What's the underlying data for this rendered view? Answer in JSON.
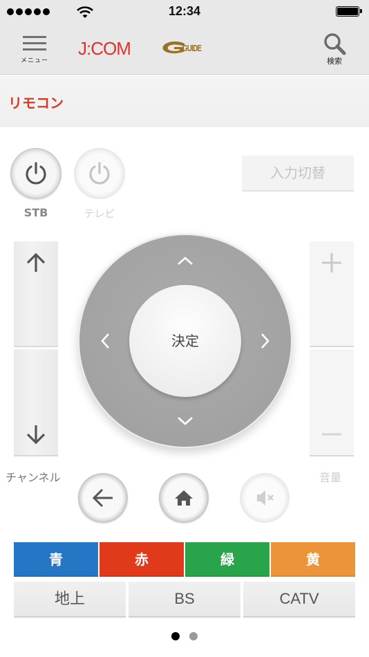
{
  "status_bar": {
    "time": "12:34",
    "signal_bars": 5,
    "wifi_icon": "wifi-icon",
    "battery_icon": "battery-full-icon"
  },
  "header": {
    "menu_label": "メニュー",
    "menu_icon": "hamburger-menu-icon",
    "brand_logo": "J:COM",
    "guide_logo": "GUIDE",
    "search_label": "検索",
    "search_icon": "magnifier-icon",
    "brand_color": "#e2312a"
  },
  "page": {
    "title": "リモコン",
    "title_color": "#d73a22"
  },
  "power": {
    "stb_label": "STB",
    "tv_label": "テレビ",
    "stb_enabled": true,
    "tv_enabled": false
  },
  "input_switch": {
    "label": "入力切替",
    "enabled": false
  },
  "channel": {
    "label": "チャンネル",
    "up_icon": "arrow-up-icon",
    "down_icon": "arrow-down-icon"
  },
  "volume": {
    "label": "音量",
    "up_icon": "plus-icon",
    "down_icon": "minus-icon",
    "enabled": false
  },
  "dpad": {
    "ok_label": "決定"
  },
  "round_buttons": [
    {
      "name": "back",
      "icon": "arrow-left-icon",
      "enabled": true
    },
    {
      "name": "home",
      "icon": "home-icon",
      "enabled": true
    },
    {
      "name": "mute",
      "icon": "mute-icon",
      "enabled": false
    }
  ],
  "color_buttons": [
    {
      "label": "青",
      "color": "#2676c6"
    },
    {
      "label": "赤",
      "color": "#e03a1b"
    },
    {
      "label": "緑",
      "color": "#2aa44a"
    },
    {
      "label": "黄",
      "color": "#ec943a"
    }
  ],
  "band_buttons": [
    {
      "label": "地上"
    },
    {
      "label": "BS"
    },
    {
      "label": "CATV"
    }
  ],
  "pager": {
    "pages": 2,
    "current": 1
  }
}
